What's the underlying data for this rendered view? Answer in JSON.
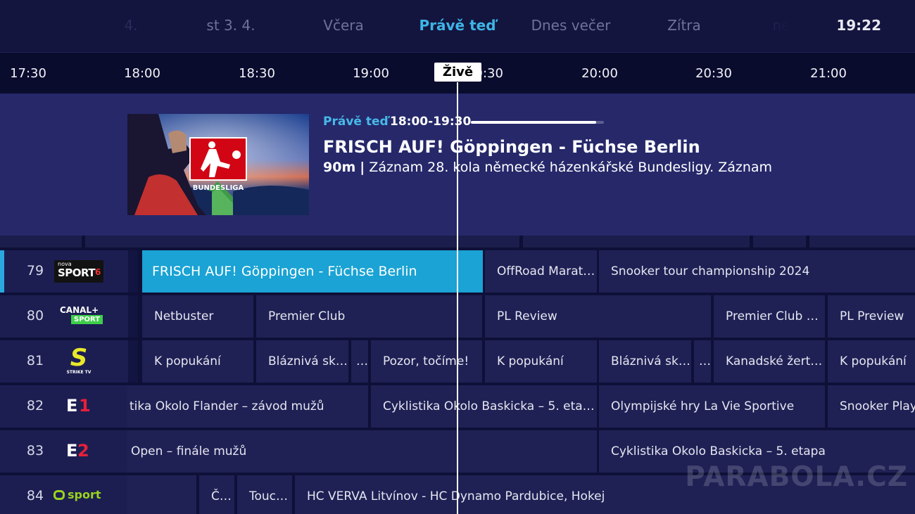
{
  "header": {
    "days": [
      "4.",
      "st 3. 4.",
      "Včera",
      "Právě teď",
      "Dnes večer",
      "Zítra",
      "ne"
    ],
    "clock": "19:22"
  },
  "timeline": {
    "ticks": [
      "17:30",
      "18:00",
      "18:30",
      "19:00",
      "19:30",
      "20:00",
      "20:30",
      "21:00"
    ],
    "live_label": "Živě"
  },
  "info": {
    "now_label": "Právě teď",
    "time_range": "18:00-19:30",
    "progress": 0.94,
    "title": "FRISCH AUF! Göppingen - Füchse Berlin",
    "duration": "90m",
    "separator": "|",
    "description": "Záznam 28. kola německé házenkářské Bundesligy. Záznam",
    "thumb_caption": "BUNDESLIGA"
  },
  "channels": [
    {
      "number": "79",
      "logo": "nova-sport-6-logo",
      "logo_text": [
        "nova",
        "SPORT",
        "6"
      ],
      "programs": [
        "FRISCH AUF! Göppingen - Füchse Berlin",
        "OffRoad Marat…",
        "Snooker tour championship 2024"
      ]
    },
    {
      "number": "80",
      "logo": "canal-plus-sport-logo",
      "logo_text": [
        "CANAL+",
        "SPORT"
      ],
      "programs": [
        "Netbuster",
        "Premier Club",
        "PL Review",
        "Premier Club E…",
        "PL Preview"
      ]
    },
    {
      "number": "81",
      "logo": "strike-tv-logo",
      "logo_text": [
        "S",
        "STRIKE TV"
      ],
      "programs": [
        "K popukání",
        "Bláznivá skr…",
        "…",
        "Pozor, točíme!",
        "K popukání",
        "Bláznivá skr…",
        "…",
        "Kanadské žertí…",
        "K popukání"
      ]
    },
    {
      "number": "82",
      "logo": "eurosport-1-logo",
      "logo_text": [
        "E",
        "1"
      ],
      "programs": [
        "tika Okolo Flander – závod mužů",
        "Cyklistika Okolo Baskicka – 5. etapa",
        "Olympijské hry La Vie Sportive",
        "Snooker Playe"
      ]
    },
    {
      "number": "83",
      "logo": "eurosport-2-logo",
      "logo_text": [
        "E",
        "2"
      ],
      "programs": [
        "Open – finále mužů",
        "Cyklistika Okolo Baskicka – 5. etapa"
      ]
    },
    {
      "number": "84",
      "logo": "ct-sport-logo",
      "logo_text": [
        "sport"
      ],
      "programs": [
        "",
        "Č…",
        "Touc…",
        "HC VERVA Litvínov - HC Dynamo Pardubice, Hokej"
      ]
    }
  ],
  "watermark": "PARABOLA.CZ",
  "colors": {
    "accent": "#1aa3d4",
    "now_label": "#47b9e8",
    "background": "#0e1038",
    "info_panel": "#26286a"
  }
}
